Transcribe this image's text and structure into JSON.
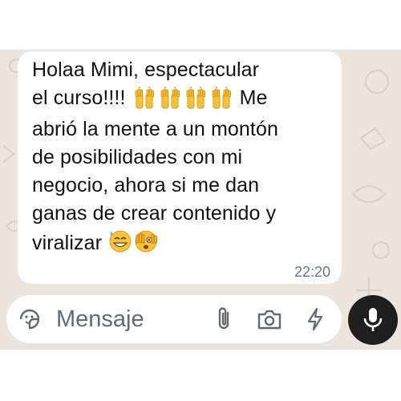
{
  "message": {
    "lines": [
      "Holaa Mimi, espectacular",
      "el curso!!!!",
      "Me",
      "abrió la mente a un montón",
      "de posibilidades con mi",
      "negocio, ahora si me dan",
      "ganas de crear contenido y",
      "viralizar"
    ],
    "time": "22:20",
    "emojis_after_curso": [
      "raising-hands",
      "raising-hands",
      "raising-hands",
      "raising-hands"
    ],
    "emojis_after_viralizar": [
      "grinning-sweat",
      "face-with-peeking-eye"
    ]
  },
  "composer": {
    "placeholder": "Mensaje",
    "icons": [
      "emoji-sticker-icon",
      "attach-icon",
      "camera-icon",
      "lightning-icon"
    ],
    "send_icon": "mic-icon"
  },
  "colors": {
    "chat_background": "#ece5dd",
    "bubble": "#ffffff",
    "timestamp": "#667781",
    "mic_button": "#1f1f1f"
  }
}
